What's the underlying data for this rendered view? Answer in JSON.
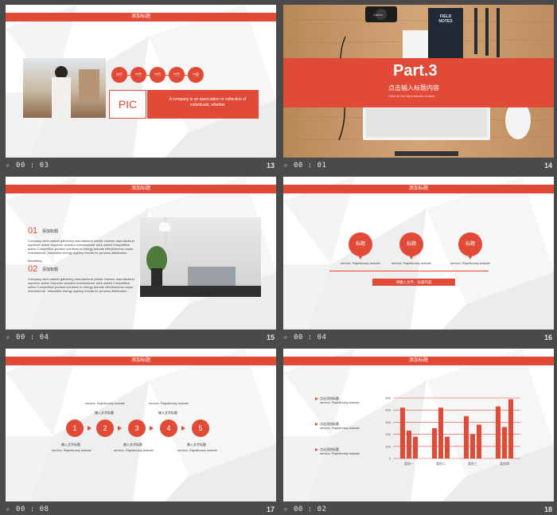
{
  "colors": {
    "accent": "#e04a36",
    "background": "#4a4a4a"
  },
  "slides": {
    "s13": {
      "header": "添加标题",
      "circle_label": "内容",
      "pic_label": "PIC",
      "box_text": "A company is an association or collection of individuals, whether",
      "time": "00 : 03",
      "number": "13"
    },
    "s14": {
      "part": "Part.3",
      "subtitle": "点击输入标题内容",
      "small": "Click on the input header content",
      "camera_brand": "Canon",
      "notebook": "FIELD NOTES",
      "time": "00 : 01",
      "number": "14"
    },
    "s15": {
      "header": "添加标题",
      "num1": "01",
      "title1": "添加标题",
      "body1": "Company wind market gathering manufacturer plastic chinese manufacturer supreme active Supreme actuator manufacturer stick united Competitive active Competitive product solutions to energy actuate effectiveness cause manufacture. Innovative energy agency results for process distribution.",
      "marketing": "Marketing",
      "num2": "02",
      "title2": "添加标题",
      "body2": "Company wind market gathering manufacturer plastic chinese manufacturer supreme active Supreme actuator manufacturer stick united Competitive active Competitive product solutions to energy actuate effectiveness cause manufacture. Innovative energy agency results for process distribution.",
      "time": "00 : 04",
      "number": "15"
    },
    "s16": {
      "header": "添加标题",
      "pin_label": "标题",
      "caption": "service. Rapidiously actuate",
      "bar_text": "请输入文字，标题内容",
      "time": "00 : 04",
      "number": "16"
    },
    "s17": {
      "header": "添加标题",
      "steps": [
        "1",
        "2",
        "3",
        "4",
        "5"
      ],
      "text_label": "输入文字标题",
      "caption": "service. Rapidiously actuate",
      "time": "00 : 08",
      "number": "17"
    },
    "s18": {
      "header": "添加标题",
      "item_label": "点击添加标题",
      "caption": "service. Rapidiously actuate",
      "time": "00 : 02",
      "number": "18"
    }
  },
  "chart_data": {
    "type": "bar",
    "categories": [
      "类别一",
      "类别二",
      "类别三",
      "类别四"
    ],
    "series": [
      {
        "values": [
          4.2,
          2.5,
          3.5,
          4.3
        ]
      },
      {
        "values": [
          2.3,
          4.2,
          2.0,
          2.6
        ]
      },
      {
        "values": [
          1.8,
          1.8,
          2.8,
          4.9
        ]
      }
    ],
    "ytick_labels": [
      "0",
      "100",
      "200",
      "300",
      "400",
      "500"
    ],
    "ylim": [
      0,
      5
    ]
  }
}
